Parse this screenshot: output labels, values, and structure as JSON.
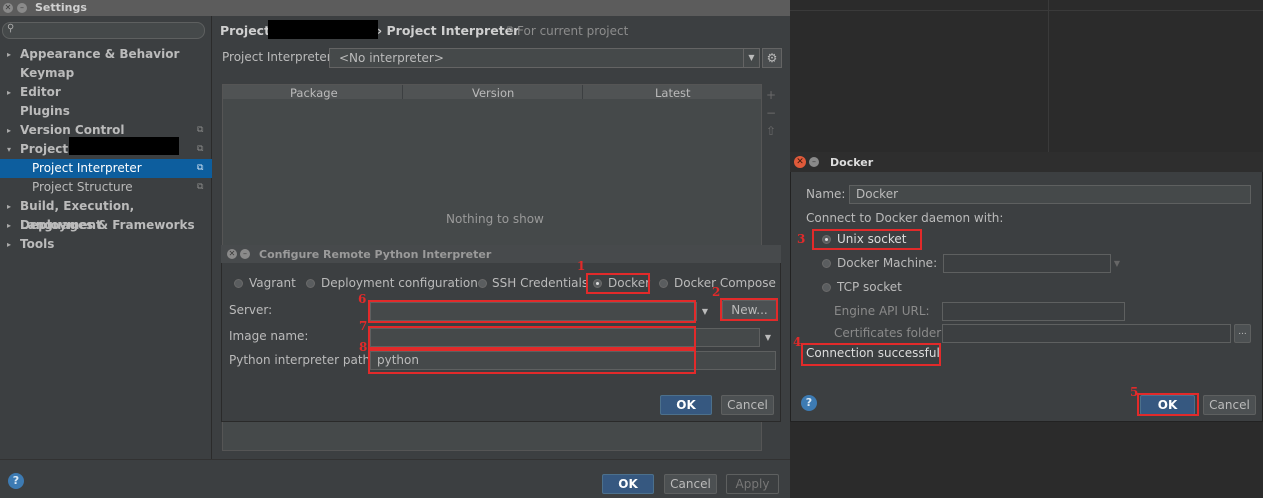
{
  "settings": {
    "window_title": "Settings",
    "search_placeholder": "",
    "nav": [
      {
        "label": "Appearance & Behavior",
        "arrow": "▸"
      },
      {
        "label": "Keymap"
      },
      {
        "label": "Editor",
        "arrow": "▸"
      },
      {
        "label": "Plugins"
      },
      {
        "label": "Version Control",
        "arrow": "▸"
      },
      {
        "label": "Project:",
        "arrow": "▾"
      },
      {
        "label": "Project Interpreter"
      },
      {
        "label": "Project Structure"
      },
      {
        "label": "Build, Execution, Deployment",
        "arrow": "▸"
      },
      {
        "label": "Languages & Frameworks",
        "arrow": "▸"
      },
      {
        "label": "Tools",
        "arrow": "▸"
      }
    ],
    "content": {
      "title_prefix": "Project:",
      "title_suffix": "› Project Interpreter",
      "subtitle": "For current project",
      "interpreter_label": "Project Interpreter:",
      "interpreter_value": "<No interpreter>",
      "table_columns": [
        "Package",
        "Version",
        "Latest"
      ],
      "empty_text": "Nothing to show"
    },
    "buttons": {
      "ok": "OK",
      "cancel": "Cancel",
      "apply": "Apply"
    },
    "help": "?"
  },
  "remote_dialog": {
    "title": "Configure Remote Python Interpreter",
    "options": [
      "Vagrant",
      "Deployment configuration",
      "SSH Credentials",
      "Docker",
      "Docker Compose"
    ],
    "selected_option": "Docker",
    "server_label": "Server:",
    "server_value": "",
    "new_button": "New...",
    "image_label": "Image name:",
    "image_value": "",
    "path_label": "Python interpreter path:",
    "path_value": "python",
    "ok": "OK",
    "cancel": "Cancel"
  },
  "docker_dialog": {
    "title": "Docker",
    "name_label": "Name:",
    "name_value": "Docker",
    "connect_label": "Connect to Docker daemon with:",
    "unix_socket": "Unix socket",
    "docker_machine": "Docker Machine:",
    "tcp_socket": "TCP socket",
    "engine_api_url": "Engine API URL:",
    "certificates_folder": "Certificates folder:",
    "status": "Connection successful",
    "browse": "...",
    "ok": "OK",
    "cancel": "Cancel",
    "help": "?"
  },
  "annotations": [
    "1",
    "2",
    "3",
    "4",
    "5",
    "6",
    "7",
    "8"
  ],
  "colors": {
    "accent": "#0d5e9e",
    "annotation": "#e22a2a",
    "primary_button": "#365880"
  }
}
